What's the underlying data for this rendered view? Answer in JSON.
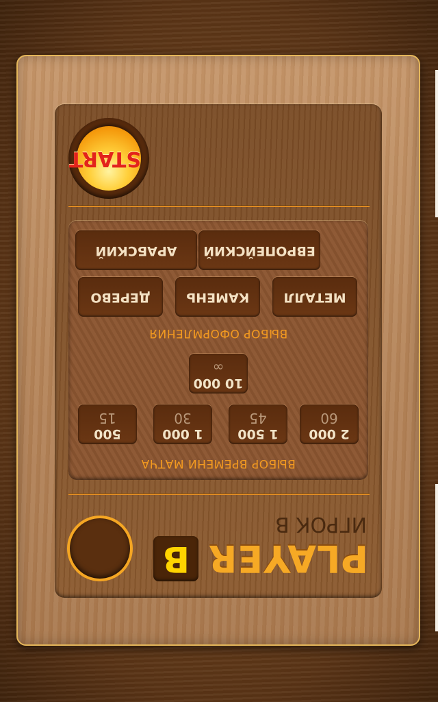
{
  "player": {
    "title": "PLAYER",
    "badge": "B",
    "subtitle": "ИГРОК B"
  },
  "time_section": {
    "title": "ВЫБОР ВРЕМЕНИ МАТЧА",
    "options": [
      {
        "label": "500",
        "sub": "15"
      },
      {
        "label": "1 000",
        "sub": "30"
      },
      {
        "label": "1 500",
        "sub": "45"
      },
      {
        "label": "2 000",
        "sub": "60"
      },
      {
        "label": "10 000",
        "sub": "∞"
      }
    ]
  },
  "style_section": {
    "title": "ВЫБОР ОФОРМЛЕНИЯ",
    "options": [
      "ДЕРЕВО",
      "КАМЕНЬ",
      "МЕТАЛЛ",
      "АРАБСКИЙ",
      "ЕВРОПЕЙСКИЙ"
    ]
  },
  "start_button": "START",
  "colors": {
    "accent": "#f6a925",
    "start_text": "#e3231b",
    "badge_text": "#ffd400"
  }
}
